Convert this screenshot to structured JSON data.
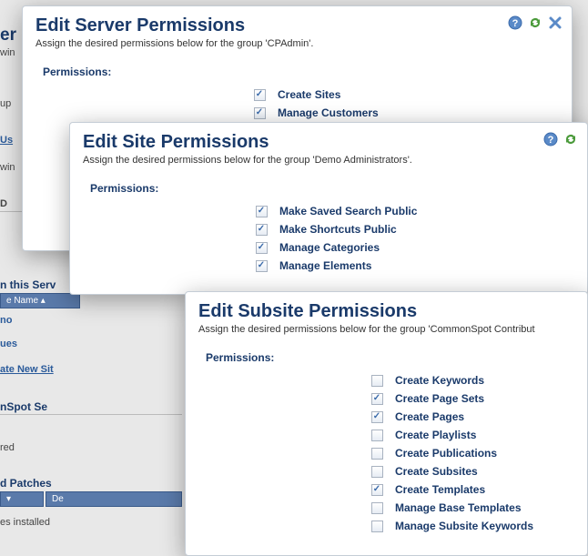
{
  "bg": {
    "er": "er",
    "win1": "win",
    "up": "up",
    "us": "Us",
    "win2": "win",
    "d": "D",
    "this_serv": "n this Serv",
    "name_hdr": "e Name",
    "no": "no",
    "ues": "ues",
    "ate_new": "ate New Sit",
    "nspot": "nSpot Se",
    "red": "red",
    "patches": "d Patches",
    "de": "De",
    "installed": "es installed"
  },
  "d1": {
    "title": "Edit Server Permissions",
    "subtitle": "Assign the desired permissions below for the group 'CPAdmin'.",
    "section": "Permissions:",
    "perms": [
      {
        "label": "Create Sites",
        "checked": true
      },
      {
        "label": "Manage Customers",
        "checked": true
      }
    ]
  },
  "d2": {
    "title": "Edit Site Permissions",
    "subtitle": "Assign the desired permissions below for the group 'Demo Administrators'.",
    "section": "Permissions:",
    "perms": [
      {
        "label": "Make Saved Search Public",
        "checked": true
      },
      {
        "label": "Make Shortcuts Public",
        "checked": true
      },
      {
        "label": "Manage Categories",
        "checked": true
      },
      {
        "label": "Manage Elements",
        "checked": true
      }
    ]
  },
  "d3": {
    "title": "Edit Subsite Permissions",
    "subtitle": "Assign the desired permissions below for the group 'CommonSpot Contribut",
    "section": "Permissions:",
    "perms": [
      {
        "label": "Create Keywords",
        "checked": false
      },
      {
        "label": "Create Page Sets",
        "checked": true
      },
      {
        "label": "Create Pages",
        "checked": true
      },
      {
        "label": "Create Playlists",
        "checked": false
      },
      {
        "label": "Create Publications",
        "checked": false
      },
      {
        "label": "Create Subsites",
        "checked": false
      },
      {
        "label": "Create Templates",
        "checked": true
      },
      {
        "label": "Manage Base Templates",
        "checked": false
      },
      {
        "label": "Manage Subsite Keywords",
        "checked": false
      }
    ]
  }
}
